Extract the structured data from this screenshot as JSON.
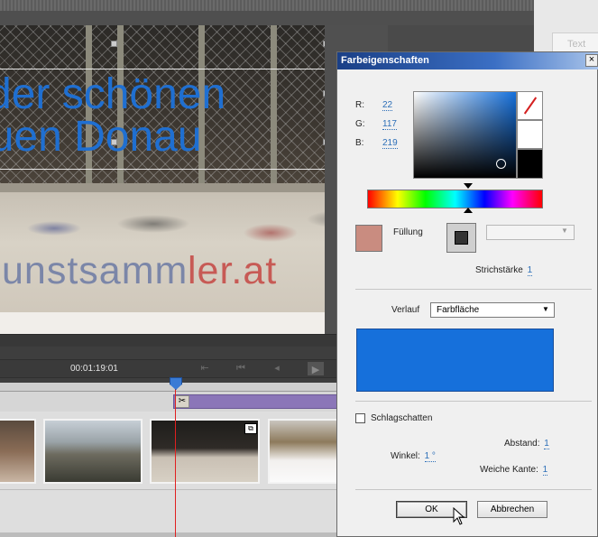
{
  "monitor": {
    "title_line1": "der schönen",
    "title_line2": "auen Donau",
    "wall_text_1": "unstsamm",
    "wall_text_2": "ler.at"
  },
  "transport": {
    "timecode": "00:01:19:01",
    "prev_marker_icon": "skip-to-start-icon",
    "step_back_icon": "step-back-icon",
    "frame_back_icon": "frame-back-icon",
    "play_icon": "play-icon"
  },
  "right_panel": {
    "tab_label": "Text"
  },
  "timeline": {
    "cut_icon": "scissors-icon",
    "cut_glyph": "✂",
    "clip_icon_glyph": "⧉"
  },
  "dialog": {
    "title": "Farbeigenschaften",
    "close_glyph": "×",
    "rgb": {
      "r_label": "R:",
      "r_value": "22",
      "g_label": "G:",
      "g_value": "117",
      "b_label": "B:",
      "b_value": "219"
    },
    "fill_label": "Füllung",
    "stroke_width_label": "Strichstärke",
    "stroke_width_value": "1",
    "gradient_label": "Verlauf",
    "gradient_select_value": "Farbfläche",
    "shadow_label": "Schlagschatten",
    "shadow_checked": false,
    "distance_label": "Abstand:",
    "distance_value": "1",
    "angle_label": "Winkel:",
    "angle_value": "1 °",
    "soft_edge_label": "Weiche Kante:",
    "soft_edge_value": "1",
    "ok_label": "OK",
    "cancel_label": "Abbrechen"
  },
  "colors": {
    "selected_color": "#1670db",
    "fill_swatch": "#c98c80",
    "title_text": "#1f6fd1",
    "timeline_clip": "#8b76b8",
    "playhead": "#e02020"
  }
}
